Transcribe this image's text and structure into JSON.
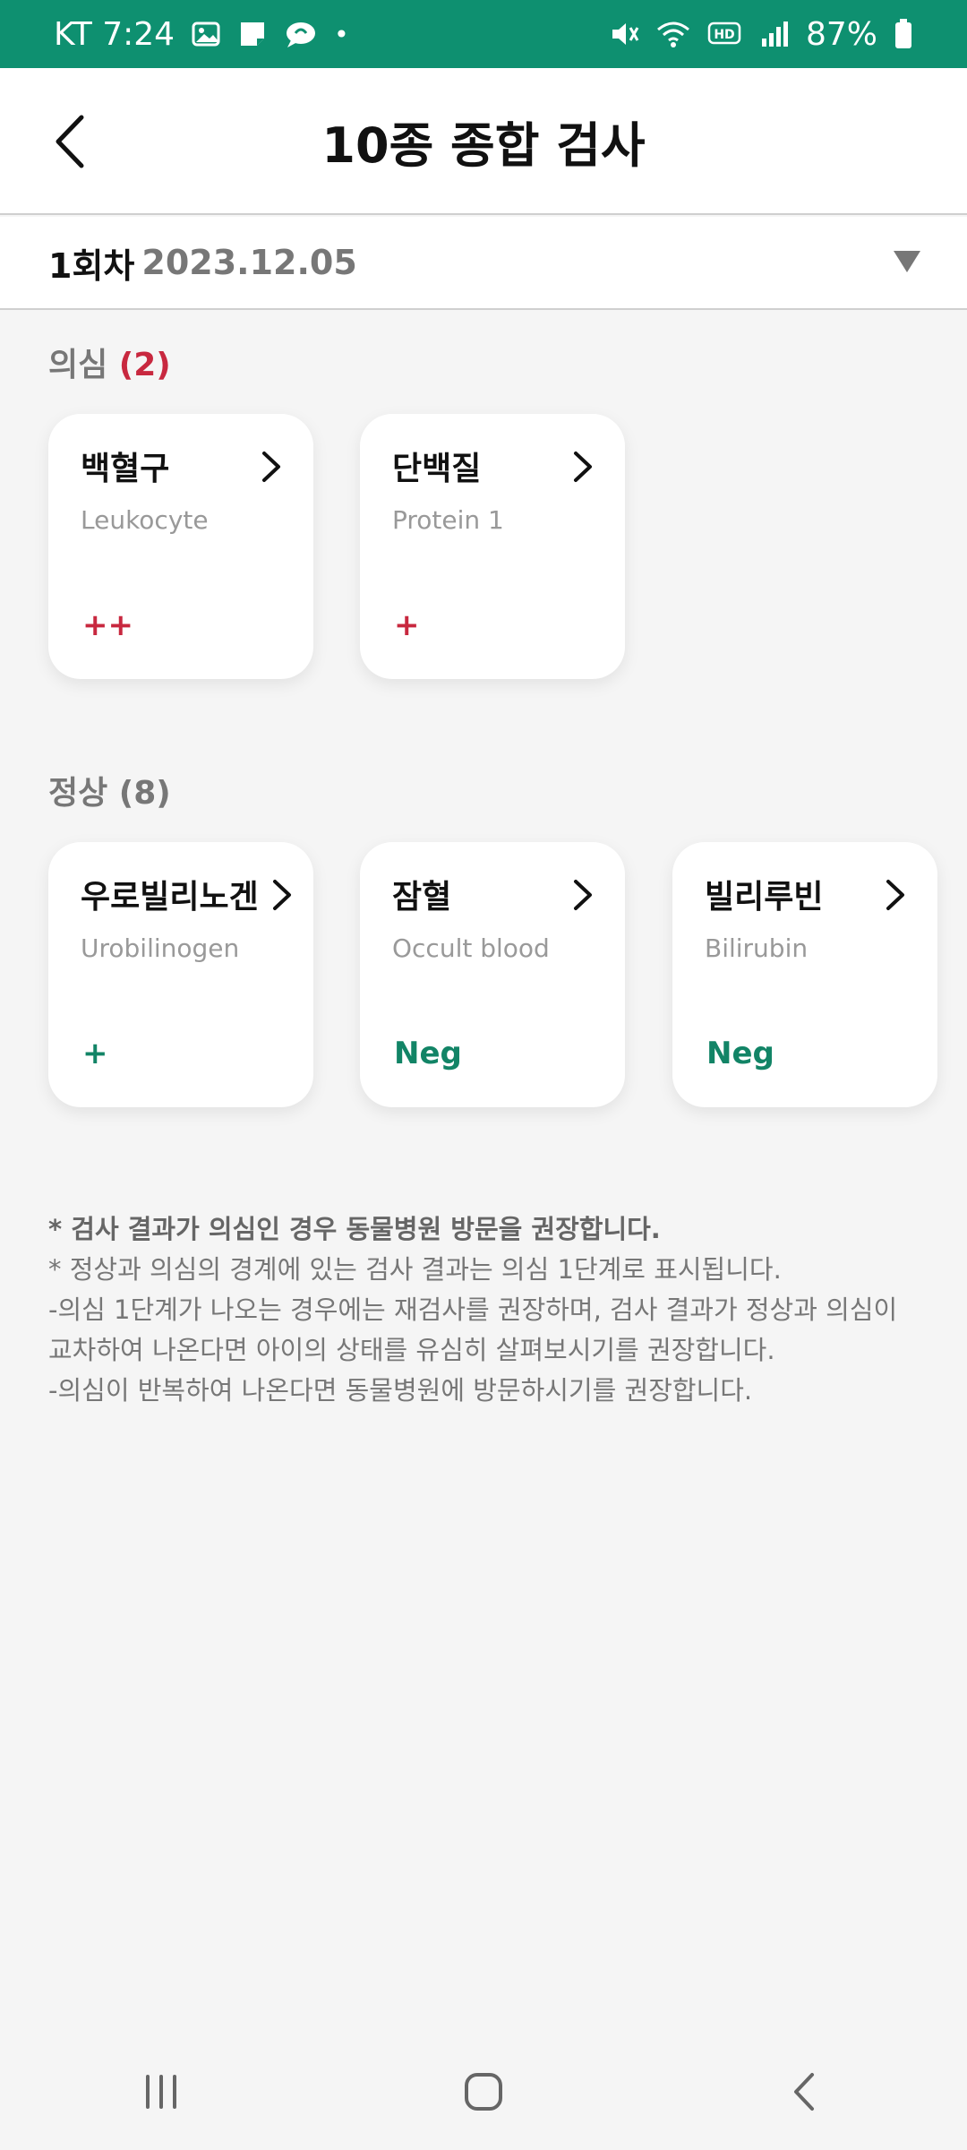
{
  "status_bar": {
    "carrier_time": "KT 7:24",
    "dot": "•",
    "battery": "87%",
    "icons": [
      "image-icon",
      "note-icon",
      "chat-icon",
      "mute-icon",
      "wifi-icon",
      "hd-icon",
      "signal-icon",
      "battery-icon"
    ]
  },
  "header": {
    "title": "10종 종합 검사"
  },
  "session": {
    "label": "1회차",
    "date": "2023.12.05"
  },
  "suspect": {
    "title": "의심",
    "count": "(2)",
    "cards": [
      {
        "name": "백혈구",
        "sub": "Leukocyte",
        "value": "++"
      },
      {
        "name": "단백질",
        "sub": "Protein 1",
        "value": "+"
      }
    ]
  },
  "normal": {
    "title": "정상",
    "count": "(8)",
    "cards": [
      {
        "name": "우로빌리노겐",
        "sub": "Urobilinogen",
        "value": "+"
      },
      {
        "name": "잠혈",
        "sub": "Occult blood",
        "value": "Neg"
      },
      {
        "name": "빌리루빈",
        "sub": "Bilirubin",
        "value": "Neg"
      }
    ]
  },
  "notes": [
    "* 검사 결과가 의심인 경우 동물병원 방문을 권장합니다.",
    "* 정상과 의심의 경계에 있는 검사 결과는 의심 1단계로 표시됩니다.",
    "-의심 1단계가 나오는 경우에는 재검사를 권장하며, 검사 결과가 정상과 의심이",
    "교차하여 나온다면 아이의 상태를 유심히 살펴보시기를 권장합니다.",
    "-의심이 반복하여 나온다면 동물병원에 방문하시기를 권장합니다."
  ],
  "colors": {
    "status_bar": "#0e9070",
    "suspect_accent": "#c8283f",
    "normal_accent": "#128466"
  }
}
